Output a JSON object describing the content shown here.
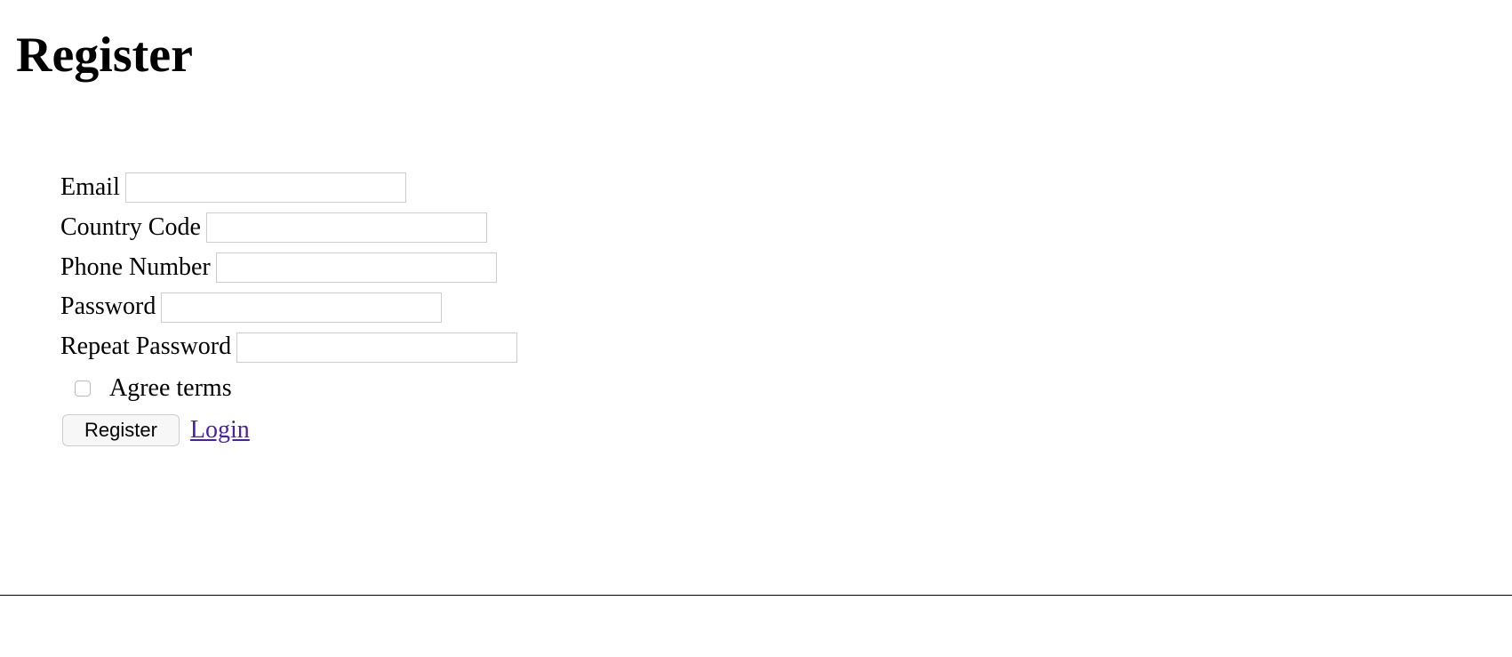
{
  "header": {
    "title": "Register"
  },
  "form": {
    "email": {
      "label": "Email",
      "value": ""
    },
    "country_code": {
      "label": "Country Code",
      "value": ""
    },
    "phone_number": {
      "label": "Phone Number",
      "value": ""
    },
    "password": {
      "label": "Password",
      "value": ""
    },
    "repeat_password": {
      "label": "Repeat Password",
      "value": ""
    },
    "agree_terms": {
      "label": "Agree terms",
      "checked": false
    },
    "submit": {
      "label": "Register"
    },
    "login_link": {
      "label": "Login"
    }
  }
}
